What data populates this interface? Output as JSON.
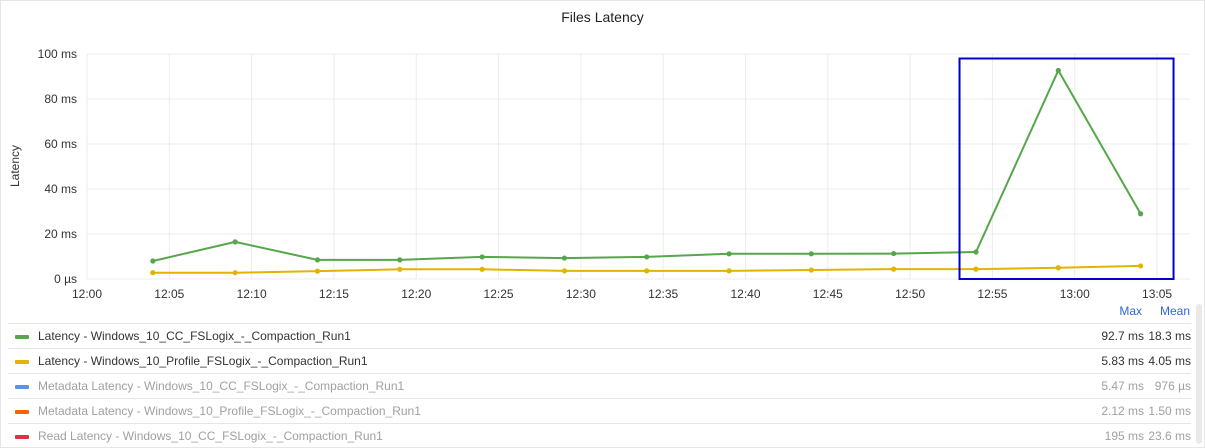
{
  "panel": {
    "title": "Files Latency"
  },
  "chart_data": {
    "type": "line",
    "title": "Files Latency",
    "ylabel": "Latency",
    "xlabel": "",
    "x_ticks": [
      "12:00",
      "12:05",
      "12:10",
      "12:15",
      "12:20",
      "12:25",
      "12:30",
      "12:35",
      "12:40",
      "12:45",
      "12:50",
      "12:55",
      "13:00",
      "13:05"
    ],
    "y_ticks": [
      "0 µs",
      "20 ms",
      "40 ms",
      "60 ms",
      "80 ms",
      "100 ms"
    ],
    "ylim": [
      0,
      100
    ],
    "y_unit": "ms",
    "x_unit": "minutes after 12:00",
    "grid": true,
    "series": [
      {
        "name": "Latency - Windows_10_CC_FSLogix_-_Compaction_Run1",
        "color": "#56a64b",
        "x": [
          4,
          9,
          14,
          19,
          24,
          29,
          34,
          39,
          44,
          49,
          54,
          59,
          64
        ],
        "values": [
          8,
          16.5,
          8.5,
          8.5,
          9.8,
          9.3,
          9.8,
          11.2,
          11.2,
          11.3,
          12,
          92.7,
          29
        ]
      },
      {
        "name": "Latency - Windows_10_Profile_FSLogix_-_Compaction_Run1",
        "color": "#e0b400",
        "x": [
          4,
          9,
          14,
          19,
          24,
          29,
          34,
          39,
          44,
          49,
          54,
          59,
          64
        ],
        "values": [
          2.8,
          2.8,
          3.5,
          4.3,
          4.3,
          3.6,
          3.6,
          3.6,
          4.0,
          4.4,
          4.4,
          5.0,
          5.8
        ]
      }
    ],
    "highlight_box": {
      "x_from": 53,
      "x_to": 66,
      "y_from": 0,
      "y_to": 98,
      "color": "#0000cc"
    }
  },
  "legend": {
    "headers": {
      "max": "Max",
      "mean": "Mean"
    },
    "rows": [
      {
        "label": "Latency - Windows_10_CC_FSLogix_-_Compaction_Run1",
        "color": "#56a64b",
        "max": "92.7 ms",
        "mean": "18.3 ms",
        "dim": false
      },
      {
        "label": "Latency - Windows_10_Profile_FSLogix_-_Compaction_Run1",
        "color": "#e0b400",
        "max": "5.83 ms",
        "mean": "4.05 ms",
        "dim": false
      },
      {
        "label": "Metadata Latency - Windows_10_CC_FSLogix_-_Compaction_Run1",
        "color": "#5794f2",
        "max": "5.47 ms",
        "mean": "976 µs",
        "dim": true
      },
      {
        "label": "Metadata Latency - Windows_10_Profile_FSLogix_-_Compaction_Run1",
        "color": "#fa6400",
        "max": "2.12 ms",
        "mean": "1.50 ms",
        "dim": true
      },
      {
        "label": "Read Latency - Windows_10_CC_FSLogix_-_Compaction_Run1",
        "color": "#e02f44",
        "max": "195 ms",
        "mean": "23.6 ms",
        "dim": true
      }
    ]
  }
}
